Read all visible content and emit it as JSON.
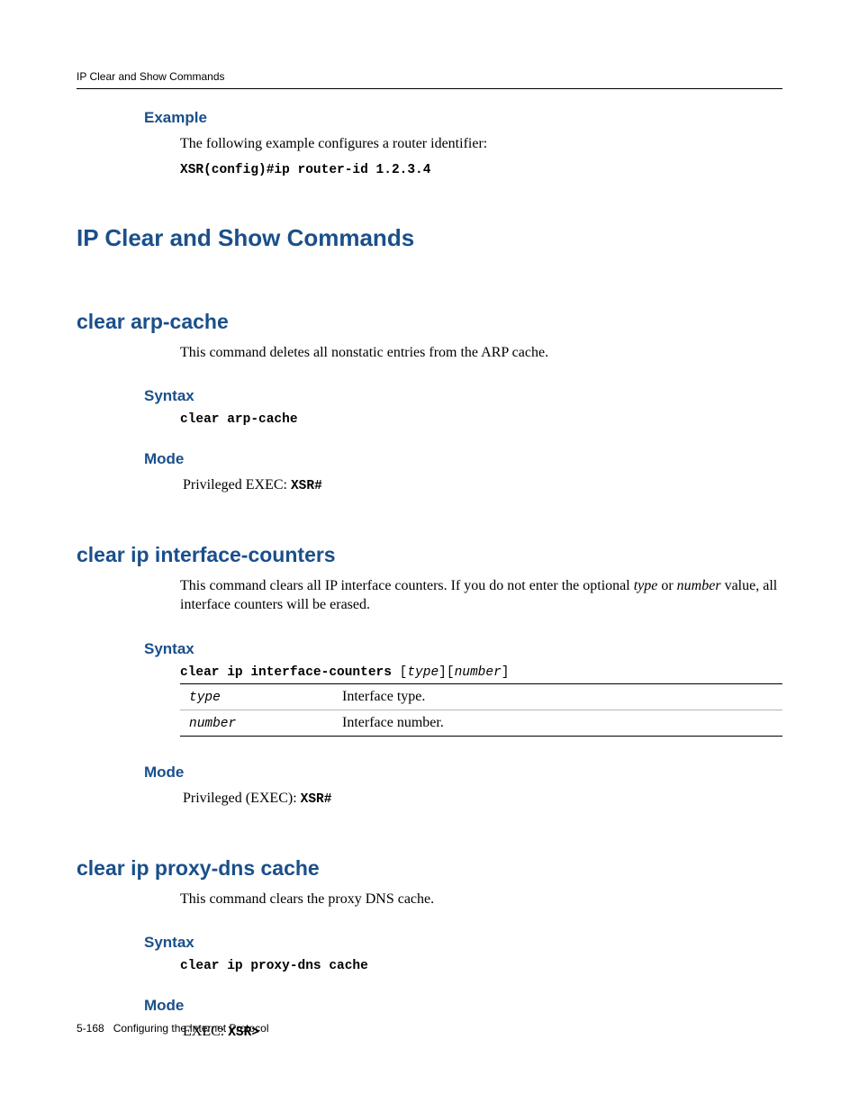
{
  "running_header": "IP Clear and Show Commands",
  "example": {
    "label": "Example",
    "text": "The following example configures a router identifier:",
    "code": "XSR(config)#ip router-id 1.2.3.4"
  },
  "h1": "IP Clear and Show Commands",
  "sec_arp": {
    "title": "clear arp-cache",
    "desc": "This command deletes all nonstatic entries from the ARP cache.",
    "syntax_label": "Syntax",
    "syntax_cmd": "clear arp-cache",
    "mode_label": "Mode",
    "mode_text_a": "Privileged EXEC: ",
    "mode_text_b": "XSR#"
  },
  "sec_ifc": {
    "title": "clear ip interface-counters",
    "desc_a": "This command clears all IP interface counters. If you do not enter the optional ",
    "desc_b": "type",
    "desc_c": " or ",
    "desc_d": "number",
    "desc_e": " value, all interface counters will be erased.",
    "syntax_label": "Syntax",
    "syntax_cmd_a": "clear ip interface-counters ",
    "syntax_cmd_b": "[",
    "syntax_cmd_c": "type",
    "syntax_cmd_d": "][",
    "syntax_cmd_e": "number",
    "syntax_cmd_f": "]",
    "params": [
      {
        "name": "type",
        "desc": "Interface type."
      },
      {
        "name": "number",
        "desc": "Interface number."
      }
    ],
    "mode_label": "Mode",
    "mode_text_a": "Privileged (EXEC): ",
    "mode_text_b": "XSR#"
  },
  "sec_dns": {
    "title": "clear ip proxy-dns cache",
    "desc": "This command clears the proxy DNS cache.",
    "syntax_label": "Syntax",
    "syntax_cmd": "clear ip proxy-dns cache",
    "mode_label": "Mode",
    "mode_text_a": "EXEC: ",
    "mode_text_b": "XSR>"
  },
  "footer": {
    "page": "5-168",
    "title": "Configuring the Internet Protocol"
  }
}
